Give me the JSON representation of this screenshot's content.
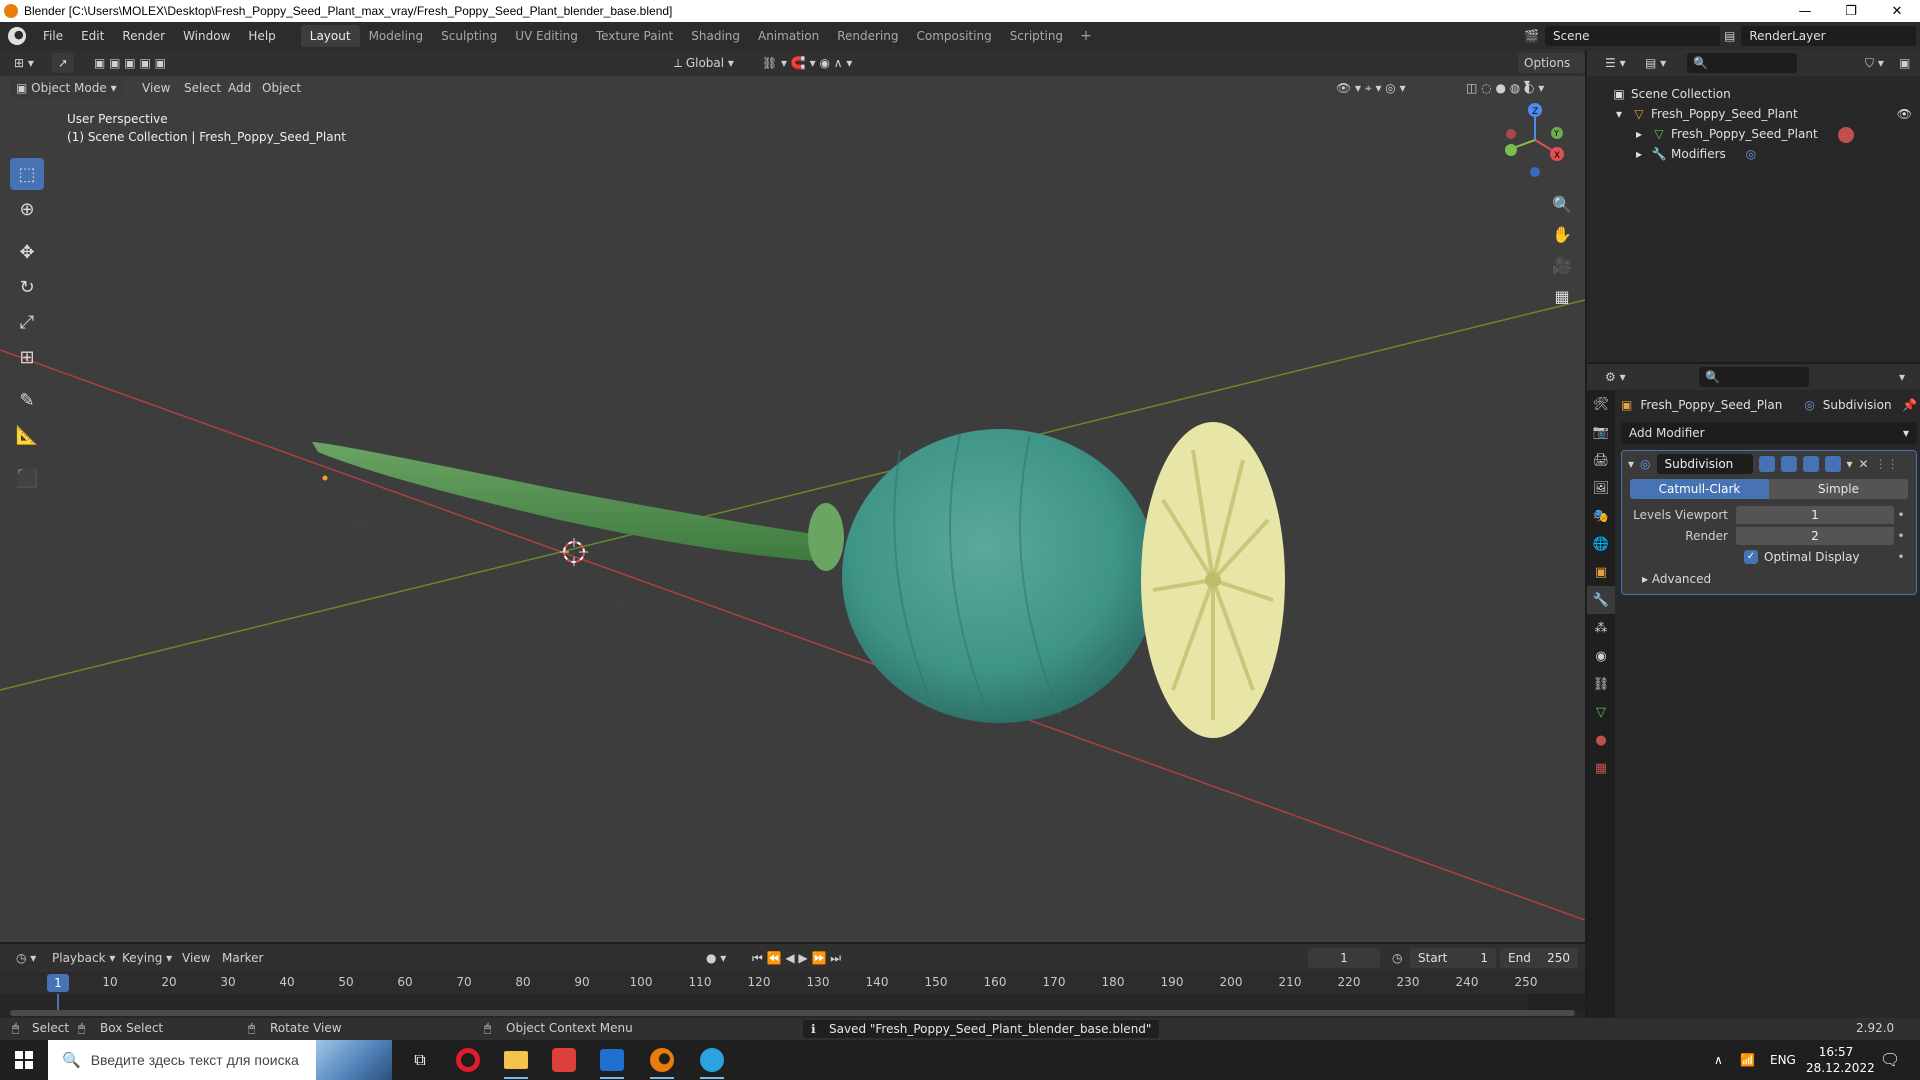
{
  "window": {
    "title": "Blender [C:\\Users\\MOLEX\\Desktop\\Fresh_Poppy_Seed_Plant_max_vray/Fresh_Poppy_Seed_Plant_blender_base.blend]",
    "controls": [
      "—",
      "❐",
      "✕"
    ]
  },
  "topbar": {
    "menus": [
      "File",
      "Edit",
      "Render",
      "Window",
      "Help"
    ],
    "workspaces": [
      "Layout",
      "Modeling",
      "Sculpting",
      "UV Editing",
      "Texture Paint",
      "Shading",
      "Animation",
      "Rendering",
      "Compositing",
      "Scripting"
    ],
    "active_workspace": "Layout",
    "add_tab": "+",
    "scene": "Scene",
    "render_layer": "RenderLayer"
  },
  "viewport_header": {
    "mode": "Object Mode",
    "menus": [
      "View",
      "Select",
      "Add",
      "Object"
    ],
    "orientation": "Global",
    "options": "Options"
  },
  "viewport": {
    "perspective": "User Perspective",
    "collection_info": "(1) Scene Collection | Fresh_Poppy_Seed_Plant",
    "gizmo_axes": [
      "Z",
      "Y",
      "X"
    ]
  },
  "outliner": {
    "root": "Scene Collection",
    "items": [
      {
        "label": "Fresh_Poppy_Seed_Plant",
        "level": 1
      },
      {
        "label": "Fresh_Poppy_Seed_Plant",
        "level": 2
      },
      {
        "label": "Modifiers",
        "level": 2
      }
    ]
  },
  "properties": {
    "object_name": "Fresh_Poppy_Seed_Plan",
    "modifier_crumb": "Subdivision",
    "add_modifier": "Add Modifier",
    "modifier": {
      "name": "Subdivision",
      "type_options": [
        "Catmull-Clark",
        "Simple"
      ],
      "selected_type": "Catmull-Clark",
      "levels_viewport_label": "Levels Viewport",
      "levels_viewport": "1",
      "render_label": "Render",
      "render": "2",
      "optimal_display_label": "Optimal Display",
      "optimal_display": true,
      "advanced_label": "Advanced"
    }
  },
  "timeline": {
    "menus": [
      "Playback",
      "Keying",
      "View",
      "Marker"
    ],
    "current_frame": "1",
    "start_label": "Start",
    "start": "1",
    "end_label": "End",
    "end": "250",
    "ruler": [
      "10",
      "20",
      "30",
      "40",
      "50",
      "60",
      "70",
      "80",
      "90",
      "100",
      "110",
      "120",
      "130",
      "140",
      "150",
      "160",
      "170",
      "180",
      "190",
      "200",
      "210",
      "220",
      "230",
      "240",
      "250"
    ],
    "ruler_current": "1"
  },
  "statusbar": {
    "select": "Select",
    "box_select": "Box Select",
    "rotate_view": "Rotate View",
    "context_menu": "Object Context Menu",
    "message": "Saved \"Fresh_Poppy_Seed_Plant_blender_base.blend\"",
    "version": "2.92.0"
  },
  "taskbar": {
    "search_placeholder": "Введите здесь текст для поиска",
    "language": "ENG",
    "time": "16:57",
    "date": "28.12.2022"
  },
  "colors": {
    "accent": "#4772b3",
    "viewport_bg": "#3d3d3d",
    "panel_bg": "#282828",
    "pod": "#3f9488",
    "stigma": "#e7e6a6"
  }
}
